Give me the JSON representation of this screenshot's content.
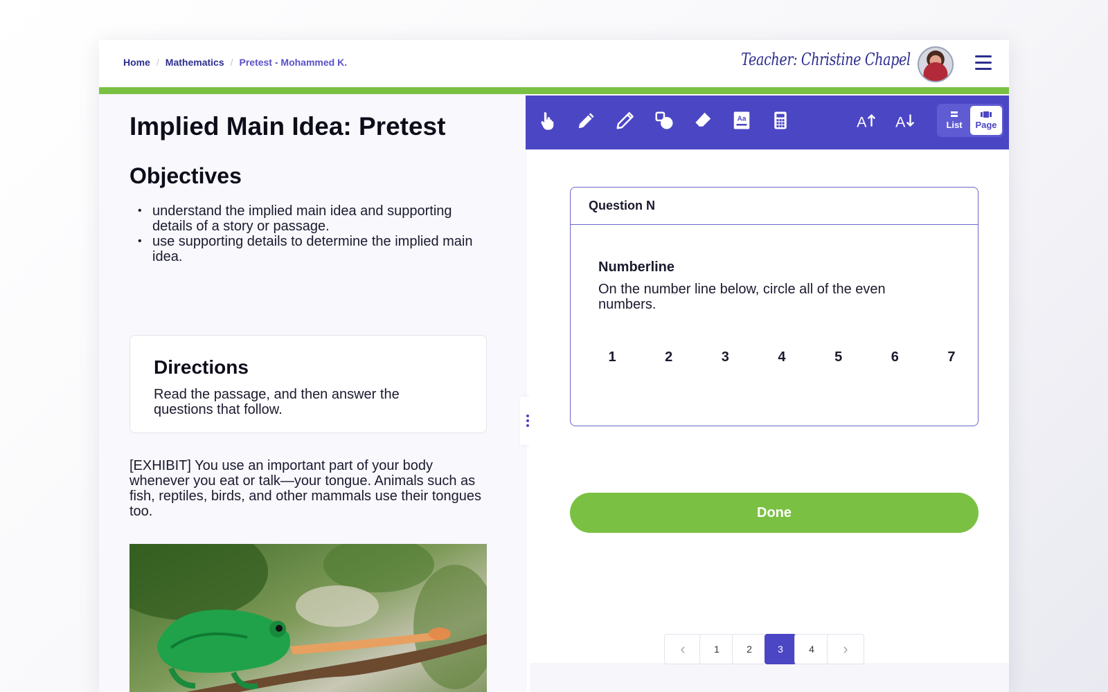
{
  "breadcrumb": {
    "home": "Home",
    "subject": "Mathematics",
    "current": "Pretest - Mohammed K.",
    "separator": "/"
  },
  "header": {
    "teacher": "Teacher: Christine Chapel",
    "accent_color": "#4b46c4",
    "progress_color": "#7ac143"
  },
  "passage": {
    "title": "Implied Main Idea: Pretest",
    "objectives_heading": "Objectives",
    "objectives": [
      "understand the implied main idea and supporting details of a story or passage.",
      "use supporting details to determine the implied main idea."
    ],
    "directions": {
      "heading": "Directions",
      "text": "Read the passage, and then answer the questions that follow."
    },
    "exhibit": "[EXHIBIT] You use an important part of your body whenever you eat or talk—your tongue. Animals such as fish, reptiles, birds, and other mammals use their tongues too."
  },
  "toolbar": {
    "tools": [
      "pointer-icon",
      "pencil-icon",
      "highlighter-icon",
      "shapes-icon",
      "eraser-icon",
      "dictionary-icon",
      "calculator-icon",
      "font-increase-icon",
      "font-decrease-icon"
    ],
    "view_list": "List",
    "view_page": "Page",
    "active_view": "Page"
  },
  "question": {
    "header": "Question N",
    "type": "Numberline",
    "prompt": "On the number line below, circle all of the even numbers.",
    "numbers": [
      "1",
      "2",
      "3",
      "4",
      "5",
      "6",
      "7"
    ],
    "done_label": "Done"
  },
  "pagination": {
    "prev": "‹",
    "next": "›",
    "pages": [
      "1",
      "2",
      "3",
      "4"
    ],
    "current": "3"
  }
}
